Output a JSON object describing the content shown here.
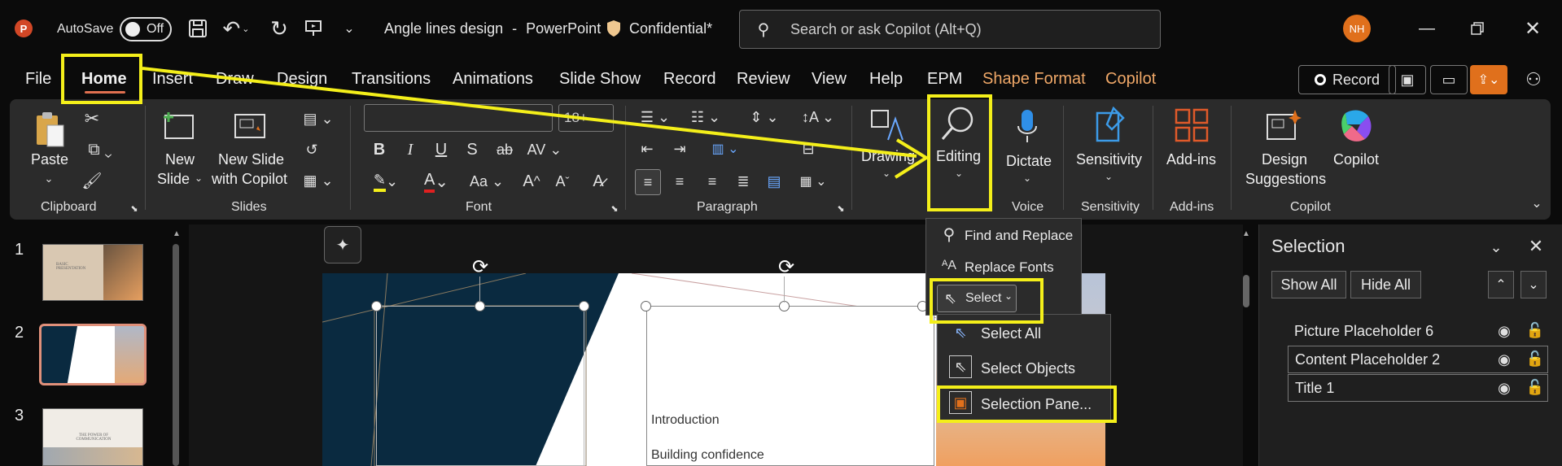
{
  "titlebar": {
    "autosave_label": "AutoSave",
    "autosave_state": "Off",
    "doc_title": "Angle lines design",
    "separator": "-",
    "app_name": "PowerPoint",
    "sensitivity_label": "Confidential*",
    "search_placeholder": "Search or ask Copilot (Alt+Q)",
    "user_initials": "NH",
    "colors": {
      "avatar": "#e0701c",
      "app_logo": "#d24726",
      "annotation": "#f4ef1a"
    }
  },
  "tabs": [
    "File",
    "Home",
    "Insert",
    "Draw",
    "Design",
    "Transitions",
    "Animations",
    "Slide Show",
    "Record",
    "Review",
    "View",
    "Help",
    "EPM",
    "Shape Format",
    "Copilot"
  ],
  "active_tab": "Home",
  "record_button": "Record",
  "ribbon": {
    "paste": "Paste",
    "clipboard_group": "Clipboard",
    "new_slide_line1": "New",
    "new_slide_line2": "Slide",
    "new_slide_copilot_line1": "New Slide",
    "new_slide_copilot_line2": "with Copilot",
    "slides_group": "Slides",
    "font_group": "Font",
    "font_size": "18+",
    "paragraph_group": "Paragraph",
    "drawing": "Drawing",
    "editing": "Editing",
    "dictate": "Dictate",
    "voice_group": "Voice",
    "sensitivity": "Sensitivity",
    "sensitivity_group": "Sensitivity",
    "addins": "Add-ins",
    "addins_group": "Add-ins",
    "design_line1": "Design",
    "design_line2": "Suggestions",
    "copilot": "Copilot",
    "copilot_group": "Copilot"
  },
  "editing_menu": {
    "find_replace": "Find and Replace",
    "replace_fonts": "Replace Fonts",
    "select": "Select"
  },
  "select_submenu": {
    "select_all": "Select All",
    "select_objects": "Select Objects",
    "selection_pane": "Selection Pane..."
  },
  "thumbnails": [
    {
      "number": "1",
      "caption": "BASIC PRESENTATION"
    },
    {
      "number": "2",
      "caption": ""
    },
    {
      "number": "3",
      "caption": "THE POWER OF COMMUNICATION"
    }
  ],
  "slide": {
    "bullet1": "Introduction",
    "bullet2": "Building confidence"
  },
  "selection_pane": {
    "title": "Selection",
    "show_all": "Show All",
    "hide_all": "Hide All",
    "items": [
      "Picture Placeholder 6",
      "Content Placeholder 2",
      "Title 1"
    ]
  }
}
